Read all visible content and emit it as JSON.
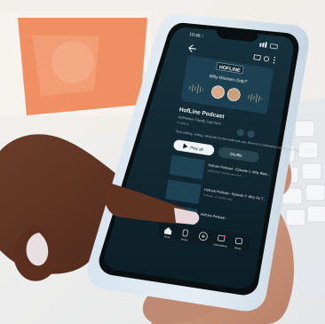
{
  "status_bar": {
    "time": "10:46 ↑"
  },
  "hero": {
    "brand": "HOFLINE",
    "banner_title": "Why Women Only?"
  },
  "podcast": {
    "title": "HofLine Podcast",
    "author": "Hofheimer Family Law Firm",
    "meta": "8 videos",
    "description": "Stop settling, setting, sitting fair for the traditional way. When it's it Hofheimer Family Law Firm."
  },
  "actions": {
    "play_all": "Play all",
    "shuffle": "Shuffle"
  },
  "episodes": [
    {
      "title": "HofLine Podcast - Episode 1: Why Wom...",
      "sub": "Hofheimer Family Law Firm"
    },
    {
      "title": "HofLine Podcast - Episode 2: Why Do T...",
      "sub": "3 views · 8 months ago"
    },
    {
      "title": "HofLine Podcast -",
      "sub": ""
    }
  ],
  "bottom_nav": [
    {
      "label": "Home",
      "icon": "home-icon"
    },
    {
      "label": "Shorts",
      "icon": "shorts-icon"
    },
    {
      "label": "",
      "icon": "add-icon"
    },
    {
      "label": "Subscriptions",
      "icon": "subscriptions-icon"
    },
    {
      "label": "Library",
      "icon": "library-icon"
    }
  ]
}
